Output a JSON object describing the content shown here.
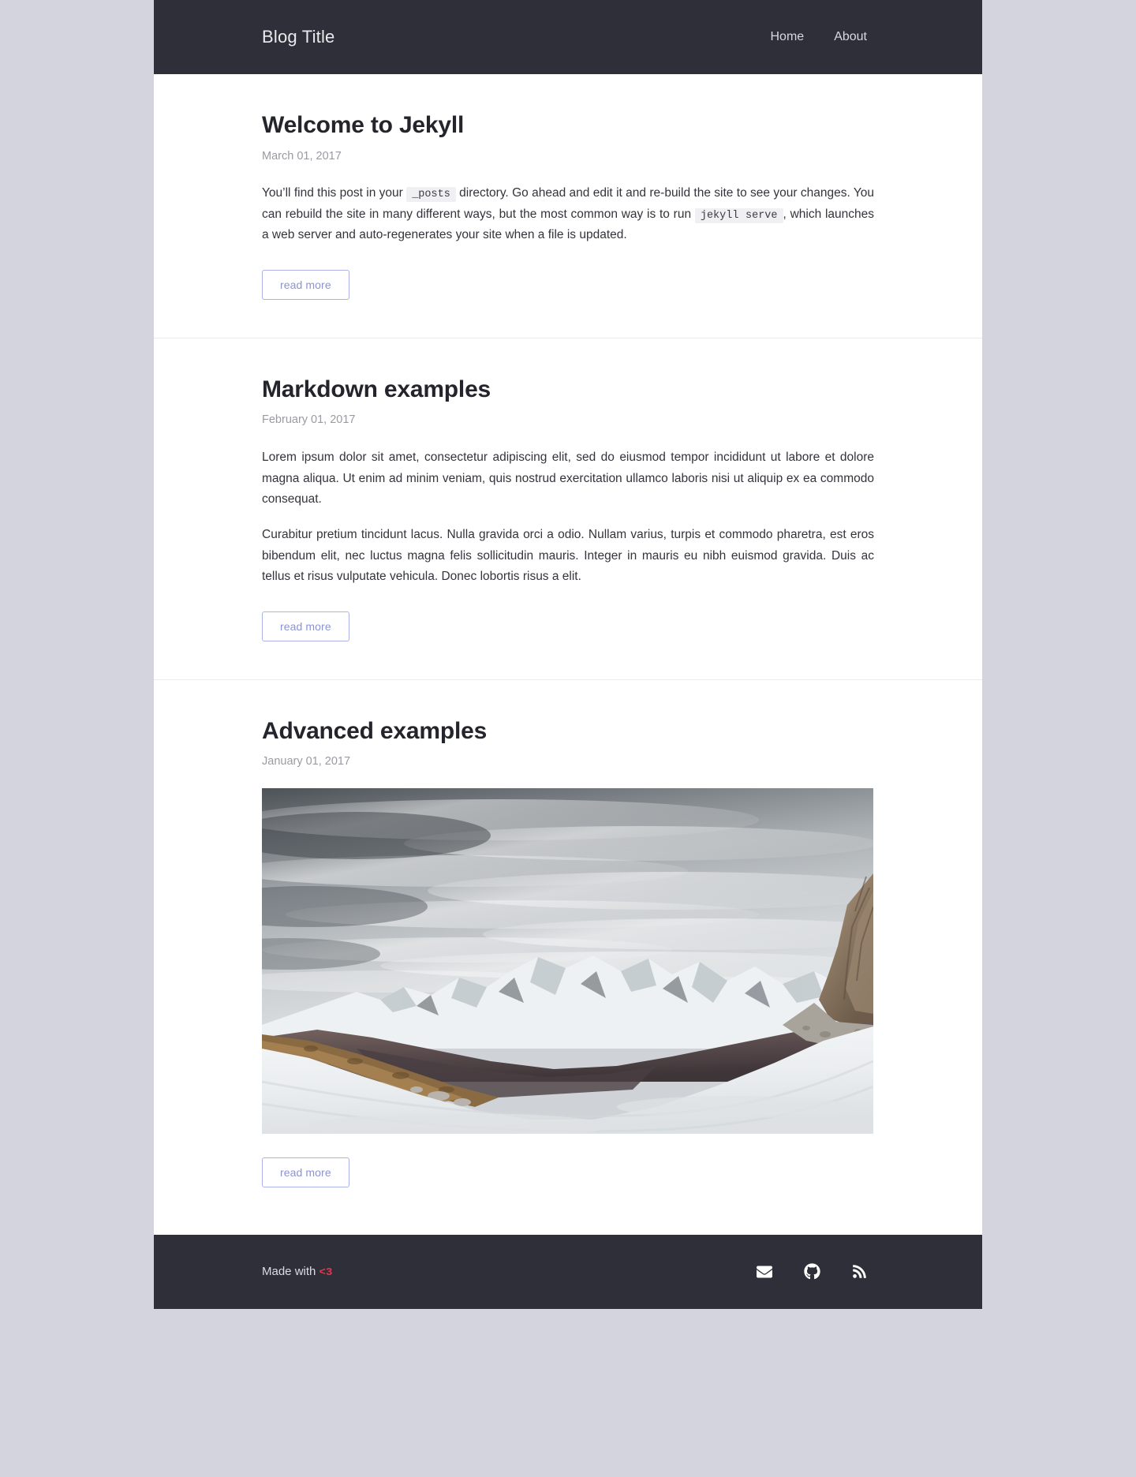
{
  "site": {
    "title": "Blog Title",
    "background_color": "#d3d4dd",
    "header_color": "#2e2f38",
    "accent_color": "#8b93d6",
    "heart_color": "#e8344e"
  },
  "nav": {
    "items": [
      {
        "label": "Home",
        "icon": "home-link"
      },
      {
        "label": "About",
        "icon": "about-link"
      }
    ]
  },
  "posts": [
    {
      "title": "Welcome to Jekyll",
      "date": "March 01, 2017",
      "paragraphs": [
        {
          "segments": [
            {
              "type": "text",
              "value": "You’ll find this post in your "
            },
            {
              "type": "code",
              "value": "_posts"
            },
            {
              "type": "text",
              "value": " directory. Go ahead and edit it and re-build the site to see your changes. You can rebuild the site in many different ways, but the most common way is to run "
            },
            {
              "type": "code",
              "value": "jekyll serve"
            },
            {
              "type": "text",
              "value": ", which launches a web server and auto-regenerates your site when a file is updated."
            }
          ]
        }
      ],
      "has_image": false,
      "read_more_label": "read more"
    },
    {
      "title": "Markdown examples",
      "date": "February 01, 2017",
      "paragraphs": [
        {
          "segments": [
            {
              "type": "text",
              "value": "Lorem ipsum dolor sit amet, consectetur adipiscing elit, sed do eiusmod tempor incididunt ut labore et dolore magna aliqua. Ut enim ad minim veniam, quis nostrud exercitation ullamco laboris nisi ut aliquip ex ea commodo consequat."
            }
          ]
        },
        {
          "segments": [
            {
              "type": "text",
              "value": "Curabitur pretium tincidunt lacus. Nulla gravida orci a odio. Nullam varius, turpis et commodo pharetra, est eros bibendum elit, nec luctus magna felis sollicitudin mauris. Integer in mauris eu nibh euismod gravida. Duis ac tellus et risus vulputate vehicula. Donec lobortis risus a elit."
            }
          ]
        }
      ],
      "has_image": false,
      "read_more_label": "read more"
    },
    {
      "title": "Advanced examples",
      "date": "January 01, 2017",
      "paragraphs": [],
      "has_image": true,
      "image_alt": "Snow-covered mountain range under dramatic grey clouds with a rocky outcrop at right",
      "read_more_label": "read more"
    }
  ],
  "footer": {
    "made_with_prefix": "Made with ",
    "made_with_heart": "<3",
    "social": [
      {
        "name": "email-icon",
        "label": "Email"
      },
      {
        "name": "github-icon",
        "label": "GitHub"
      },
      {
        "name": "rss-icon",
        "label": "RSS Feed"
      }
    ]
  }
}
